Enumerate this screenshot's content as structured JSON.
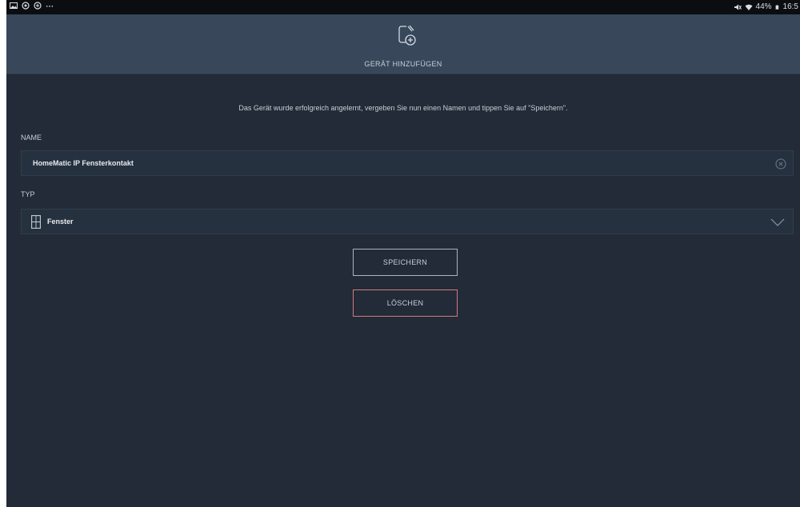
{
  "statusbar": {
    "left_icons": [
      "gallery-icon",
      "app-icon",
      "app-icon-2",
      "more-dots-icon"
    ],
    "right_icons": [
      "mute-icon",
      "wifi-icon"
    ],
    "battery": "44%",
    "time": "16:5"
  },
  "header": {
    "title": "GERÄT HINZUFÜGEN",
    "icon": "add-device-icon"
  },
  "instruction": "Das Gerät wurde erfolgreich angelernt, vergeben Sie nun einen Namen und tippen Sie auf \"Speichern\".",
  "name_field": {
    "label": "NAME",
    "value": "HomeMatic IP Fensterkontakt",
    "clear_icon": "clear-icon"
  },
  "type_field": {
    "label": "TYP",
    "value": "Fenster",
    "icon": "window-icon",
    "dropdown_icon": "chevron-down-icon"
  },
  "buttons": {
    "save": "SPEICHERN",
    "delete": "LÖSCHEN"
  },
  "colors": {
    "background": "#222b37",
    "header": "#38475a",
    "save_border": "#aab5c3",
    "delete_border": "#d07a7e"
  }
}
